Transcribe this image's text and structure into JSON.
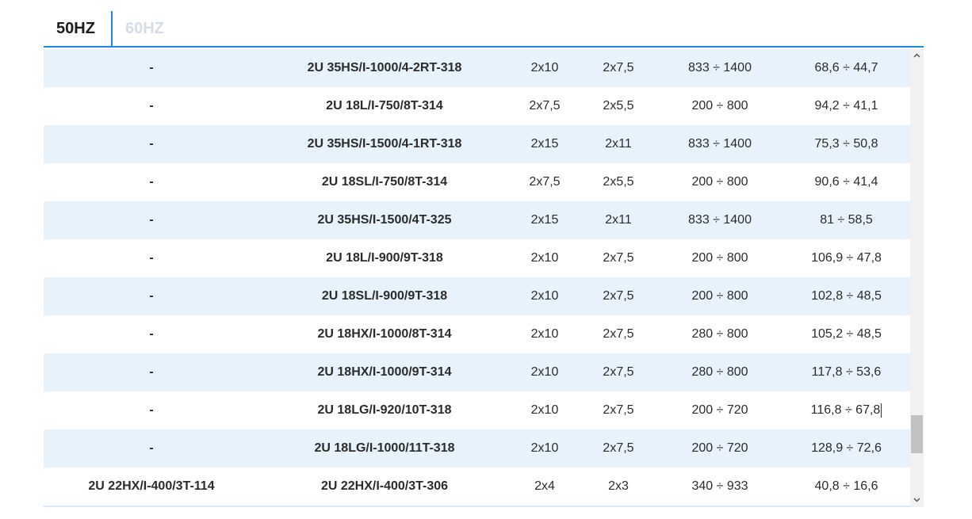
{
  "tabs": [
    {
      "label": "50HZ",
      "active": true
    },
    {
      "label": "60HZ",
      "active": false
    }
  ],
  "rows": [
    [
      "-",
      "2U 35HS/I-1000/4-2RT-318",
      "2x10",
      "2x7,5",
      "833 ÷ 1400",
      "68,6 ÷ 44,7"
    ],
    [
      "-",
      "2U 18L/I-750/8T-314",
      "2x7,5",
      "2x5,5",
      "200 ÷ 800",
      "94,2 ÷ 41,1"
    ],
    [
      "-",
      "2U 35HS/I-1500/4-1RT-318",
      "2x15",
      "2x11",
      "833 ÷ 1400",
      "75,3 ÷ 50,8"
    ],
    [
      "-",
      "2U 18SL/I-750/8T-314",
      "2x7,5",
      "2x5,5",
      "200 ÷ 800",
      "90,6 ÷ 41,4"
    ],
    [
      "-",
      "2U 35HS/I-1500/4T-325",
      "2x15",
      "2x11",
      "833 ÷ 1400",
      "81 ÷ 58,5"
    ],
    [
      "-",
      "2U 18L/I-900/9T-318",
      "2x10",
      "2x7,5",
      "200 ÷ 800",
      "106,9 ÷ 47,8"
    ],
    [
      "-",
      "2U 18SL/I-900/9T-318",
      "2x10",
      "2x7,5",
      "200 ÷ 800",
      "102,8 ÷ 48,5"
    ],
    [
      "-",
      "2U 18HX/I-1000/8T-314",
      "2x10",
      "2x7,5",
      "280 ÷ 800",
      "105,2 ÷ 48,5"
    ],
    [
      "-",
      "2U 18HX/I-1000/9T-314",
      "2x10",
      "2x7,5",
      "280 ÷ 800",
      "117,8 ÷ 53,6"
    ],
    [
      "-",
      "2U 18LG/I-920/10T-318",
      "2x10",
      "2x7,5",
      "200 ÷ 720",
      "116,8 ÷ 67,8"
    ],
    [
      "-",
      "2U 18LG/I-1000/11T-318",
      "2x10",
      "2x7,5",
      "200 ÷ 720",
      "128,9 ÷ 72,6"
    ],
    [
      "2U 22HX/I-400/3T-114",
      "2U 22HX/I-400/3T-306",
      "2x4",
      "2x3",
      "340 ÷ 933",
      "40,8 ÷ 16,6"
    ]
  ],
  "scrollbar": {
    "up_icon": "chevron-up-icon",
    "down_icon": "chevron-down-icon",
    "position_fraction": 0.83
  },
  "colors": {
    "accent": "#1e88e5",
    "row_alt": "#e8f2fd",
    "tab_inactive": "#d6dce6"
  }
}
